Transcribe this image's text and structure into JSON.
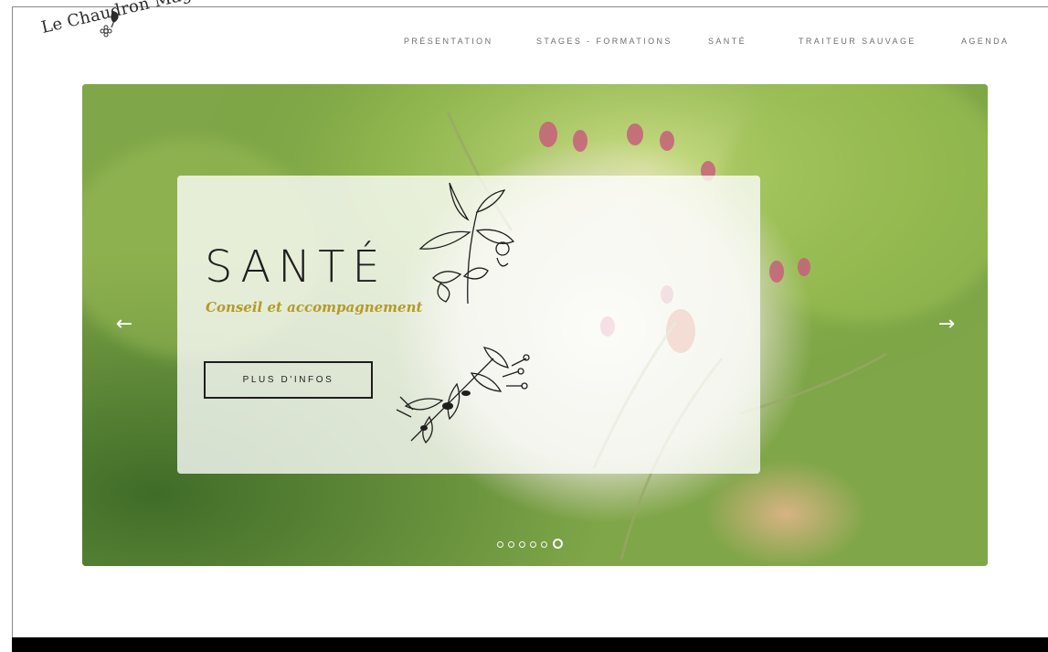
{
  "site": {
    "logo_text": "Le Chaudron Magique..."
  },
  "nav": {
    "items": [
      {
        "label": "PRÉSENTATION"
      },
      {
        "label": "STAGES - FORMATIONS"
      },
      {
        "label": "SANTÉ"
      },
      {
        "label": "TRAITEUR SAUVAGE"
      },
      {
        "label": "AGENDA"
      }
    ]
  },
  "slider": {
    "title": "SANTÉ",
    "subtitle": "Conseil et accompagnement",
    "cta_label": "PLUS D'INFOS",
    "prev_arrow": "←",
    "next_arrow": "→",
    "slide_count": 6,
    "active_slide": 6
  },
  "icons": {
    "logo": "leaf-flower-icon",
    "prev": "arrow-left-icon",
    "next": "arrow-right-icon"
  },
  "colors": {
    "subtitle_accent": "#b49a28",
    "footer": "#000000",
    "nav_text": "#6e6e6e"
  }
}
